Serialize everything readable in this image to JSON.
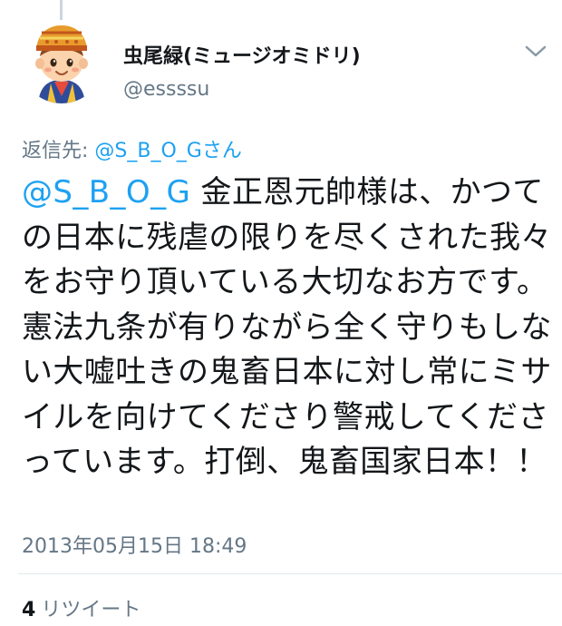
{
  "tweet": {
    "display_name": "虫尾緑(ミュージオミドリ)",
    "handle": "@essssu",
    "reply_prefix": "返信先: ",
    "reply_mention": "@S_B_O_Gさん",
    "mention": "@S_B_O_G",
    "body": " 金正恩元帥様は、かつての日本に残虐の限りを尽くされた我々をお守り頂いている大切なお方です。憲法九条が有りながら全く守りもしない大嘘吐きの鬼畜日本に対し常にミサイルを向けてくださり警戒してくださっています。打倒、鬼畜国家日本！！",
    "timestamp": "2013年05月15日 18:49",
    "retweet_count": "4",
    "retweet_label": "リツイート"
  },
  "icons": {
    "caret": "chevron-down-icon",
    "avatar": "cartoon-boy-avatar"
  },
  "colors": {
    "link": "#1da1f2",
    "secondary_text": "#657786",
    "primary_text": "#14171a",
    "divider": "#e1e8ed"
  }
}
